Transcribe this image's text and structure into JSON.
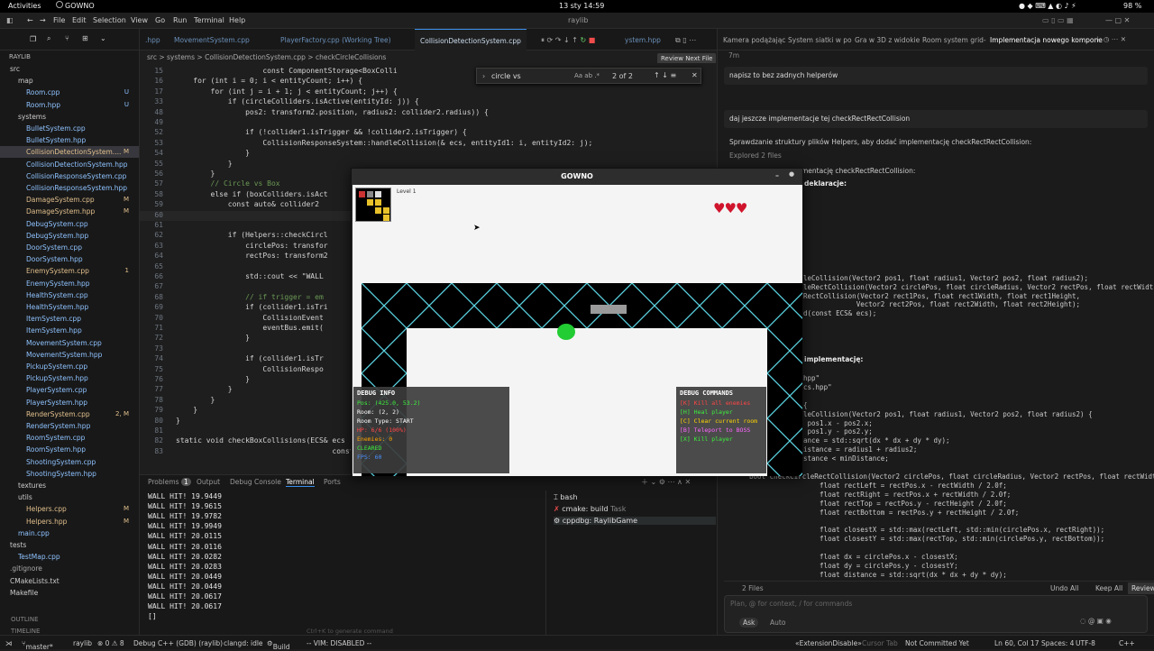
{
  "topbar": {
    "activities": "Activities",
    "app": "GOWNO",
    "clock": "13 sty  14:59",
    "battery": "98 %"
  },
  "menu": [
    "File",
    "Edit",
    "Selection",
    "View",
    "Go",
    "Run",
    "Terminal",
    "Help"
  ],
  "search_center": "raylib",
  "sidebar": {
    "project": "RAYLIB",
    "items": [
      {
        "t": "src",
        "d": 1,
        "c": "#ccc",
        "s": ""
      },
      {
        "t": "map",
        "d": 2,
        "c": "#ccc",
        "s": ""
      },
      {
        "t": "Room.cpp",
        "d": 3,
        "c": "#8fc3ff",
        "s": "U"
      },
      {
        "t": "Room.hpp",
        "d": 3,
        "c": "#8fc3ff",
        "s": "U"
      },
      {
        "t": "systems",
        "d": 2,
        "c": "#ccc",
        "s": ""
      },
      {
        "t": "BulletSystem.cpp",
        "d": 3,
        "c": "#8fc3ff",
        "s": ""
      },
      {
        "t": "BulletSystem.hpp",
        "d": 3,
        "c": "#8fc3ff",
        "s": ""
      },
      {
        "t": "CollisionDetectionSystem....",
        "d": 3,
        "c": "#e2c08d",
        "s": "M"
      },
      {
        "t": "CollisionDetectionSystem.hpp",
        "d": 3,
        "c": "#8fc3ff",
        "s": ""
      },
      {
        "t": "CollisionResponseSystem.cpp",
        "d": 3,
        "c": "#8fc3ff",
        "s": ""
      },
      {
        "t": "CollisionResponseSystem.hpp",
        "d": 3,
        "c": "#8fc3ff",
        "s": ""
      },
      {
        "t": "DamageSystem.cpp",
        "d": 3,
        "c": "#e2c08d",
        "s": "M"
      },
      {
        "t": "DamageSystem.hpp",
        "d": 3,
        "c": "#e2c08d",
        "s": "M"
      },
      {
        "t": "DebugSystem.cpp",
        "d": 3,
        "c": "#8fc3ff",
        "s": ""
      },
      {
        "t": "DebugSystem.hpp",
        "d": 3,
        "c": "#8fc3ff",
        "s": ""
      },
      {
        "t": "DoorSystem.cpp",
        "d": 3,
        "c": "#8fc3ff",
        "s": ""
      },
      {
        "t": "DoorSystem.hpp",
        "d": 3,
        "c": "#8fc3ff",
        "s": ""
      },
      {
        "t": "EnemySystem.cpp",
        "d": 3,
        "c": "#e2c08d",
        "s": "1"
      },
      {
        "t": "EnemySystem.hpp",
        "d": 3,
        "c": "#8fc3ff",
        "s": ""
      },
      {
        "t": "HealthSystem.cpp",
        "d": 3,
        "c": "#8fc3ff",
        "s": ""
      },
      {
        "t": "HealthSystem.hpp",
        "d": 3,
        "c": "#8fc3ff",
        "s": ""
      },
      {
        "t": "ItemSystem.cpp",
        "d": 3,
        "c": "#8fc3ff",
        "s": ""
      },
      {
        "t": "ItemSystem.hpp",
        "d": 3,
        "c": "#8fc3ff",
        "s": ""
      },
      {
        "t": "MovementSystem.cpp",
        "d": 3,
        "c": "#8fc3ff",
        "s": ""
      },
      {
        "t": "MovementSystem.hpp",
        "d": 3,
        "c": "#8fc3ff",
        "s": ""
      },
      {
        "t": "PickupSystem.cpp",
        "d": 3,
        "c": "#8fc3ff",
        "s": ""
      },
      {
        "t": "PickupSystem.hpp",
        "d": 3,
        "c": "#8fc3ff",
        "s": ""
      },
      {
        "t": "PlayerSystem.cpp",
        "d": 3,
        "c": "#8fc3ff",
        "s": ""
      },
      {
        "t": "PlayerSystem.hpp",
        "d": 3,
        "c": "#8fc3ff",
        "s": ""
      },
      {
        "t": "RenderSystem.cpp",
        "d": 3,
        "c": "#e2c08d",
        "s": "2, M"
      },
      {
        "t": "RenderSystem.hpp",
        "d": 3,
        "c": "#8fc3ff",
        "s": ""
      },
      {
        "t": "RoomSystem.cpp",
        "d": 3,
        "c": "#8fc3ff",
        "s": ""
      },
      {
        "t": "RoomSystem.hpp",
        "d": 3,
        "c": "#8fc3ff",
        "s": ""
      },
      {
        "t": "ShootingSystem.cpp",
        "d": 3,
        "c": "#8fc3ff",
        "s": ""
      },
      {
        "t": "ShootingSystem.hpp",
        "d": 3,
        "c": "#8fc3ff",
        "s": ""
      },
      {
        "t": "textures",
        "d": 2,
        "c": "#ccc",
        "s": ""
      },
      {
        "t": "utils",
        "d": 2,
        "c": "#ccc",
        "s": ""
      },
      {
        "t": "Helpers.cpp",
        "d": 3,
        "c": "#e2c08d",
        "s": "M"
      },
      {
        "t": "Helpers.hpp",
        "d": 3,
        "c": "#e2c08d",
        "s": "M"
      },
      {
        "t": "main.cpp",
        "d": 2,
        "c": "#8fc3ff",
        "s": ""
      },
      {
        "t": "tests",
        "d": 1,
        "c": "#ccc",
        "s": ""
      },
      {
        "t": "TestMap.cpp",
        "d": 2,
        "c": "#8fc3ff",
        "s": ""
      },
      {
        "t": ".gitignore",
        "d": 1,
        "c": "#aaa",
        "s": ""
      },
      {
        "t": "CMakeLists.txt",
        "d": 1,
        "c": "#ccc",
        "s": ""
      },
      {
        "t": "Makefile",
        "d": 1,
        "c": "#ccc",
        "s": ""
      }
    ],
    "outline": "OUTLINE",
    "timeline": "TIMELINE"
  },
  "editor_tabs": [
    ".hpp",
    "MovementSystem.cpp",
    "PlayerFactory.cpp (Working Tree)",
    "CollisionDetectionSystem.cpp",
    "ystem.hpp"
  ],
  "breadcrumbs": "src  >  systems  >  CollisionDetectionSystem.cpp  >  checkCircleCollisions",
  "review_next": "Review Next File",
  "find": {
    "query": "circle vs",
    "count": "2 of 2",
    "flags": "Aa  ab  .*"
  },
  "code": [
    {
      "n": "15",
      "t": "                    const ComponentStorage<BoxColli"
    },
    {
      "n": "16",
      "t": "    for (int i = 0; i < entityCount; i++) {"
    },
    {
      "n": "17",
      "t": "        for (int j = i + 1; j < entityCount; j++) {"
    },
    {
      "n": "33",
      "t": "            if (circleColliders.isActive(entityId: j)) {"
    },
    {
      "n": "48",
      "t": "                pos2: transform2.position, radius2: collider2.radius)) {"
    },
    {
      "n": "49",
      "t": ""
    },
    {
      "n": "52",
      "t": "                if (!collider1.isTrigger && !collider2.isTrigger) {"
    },
    {
      "n": "53",
      "t": "                    CollisionResponseSystem::handleCollision(& ecs, entityId1: i, entityId2: j);"
    },
    {
      "n": "54",
      "t": "                }"
    },
    {
      "n": "55",
      "t": "            }"
    },
    {
      "n": "56",
      "t": "        }"
    },
    {
      "n": "57",
      "t": "        // Circle vs Box"
    },
    {
      "n": "58",
      "t": "        else if (boxColliders.isAct"
    },
    {
      "n": "59",
      "t": "            const auto& collider2"
    },
    {
      "n": "60",
      "t": ""
    },
    {
      "n": "61",
      "t": ""
    },
    {
      "n": "62",
      "t": "            if (Helpers::checkCircl"
    },
    {
      "n": "63",
      "t": "                circlePos: transfor"
    },
    {
      "n": "64",
      "t": "                rectPos: transform2"
    },
    {
      "n": "65",
      "t": ""
    },
    {
      "n": "66",
      "t": "                std::cout << \"WALL"
    },
    {
      "n": "67",
      "t": ""
    },
    {
      "n": "68",
      "t": "                // if trigger = em"
    },
    {
      "n": "69",
      "t": "                if (collider1.isTri"
    },
    {
      "n": "70",
      "t": "                    CollisionEvent"
    },
    {
      "n": "71",
      "t": "                    eventBus.emit("
    },
    {
      "n": "72",
      "t": "                }"
    },
    {
      "n": "73",
      "t": ""
    },
    {
      "n": "74",
      "t": "                if (collider1.isTr"
    },
    {
      "n": "75",
      "t": "                    CollisionRespo"
    },
    {
      "n": "76",
      "t": "                }"
    },
    {
      "n": "77",
      "t": "            }"
    },
    {
      "n": "78",
      "t": "        }"
    },
    {
      "n": "79",
      "t": "    }"
    },
    {
      "n": "80",
      "t": "}"
    },
    {
      "n": "81",
      "t": ""
    },
    {
      "n": "82",
      "t": "static void checkBoxCollisions(ECS& ecs"
    },
    {
      "n": "83",
      "t": "                                    const st"
    }
  ],
  "panel_tabs": [
    "Problems",
    "Output",
    "Debug Console",
    "Terminal",
    "Ports"
  ],
  "problems_count": "1",
  "terminal_lines": [
    "WALL HIT! 19.9449",
    "WALL HIT! 19.9615",
    "WALL HIT! 19.9782",
    "WALL HIT! 19.9949",
    "WALL HIT! 20.0115",
    "WALL HIT! 20.0116",
    "WALL HIT! 20.0282",
    "WALL HIT! 20.0283",
    "WALL HIT! 20.0449",
    "WALL HIT! 20.0449",
    "WALL HIT! 20.0617",
    "WALL HIT! 20.0617",
    "[]"
  ],
  "terminals": [
    {
      "name": "bash"
    },
    {
      "name": "cmake: build",
      "extra": "Task"
    },
    {
      "name": "cppdbg: RaylibGame"
    }
  ],
  "ctrlk": "Ctrl+K to generate command",
  "game": {
    "title": "GOWNO",
    "level": "Level 1",
    "hearts": 3,
    "debug_info": {
      "title": "DEBUG INFO",
      "lines": [
        {
          "t": "Pos: (425.0, 53.2)",
          "c": "#3df03d"
        },
        {
          "t": "Room: (2, 2)",
          "c": "#fff"
        },
        {
          "t": "Room Type: START",
          "c": "#fff"
        },
        {
          "t": "HP: 6/6 (100%)",
          "c": "#ff4444"
        },
        {
          "t": "Enemies: 0",
          "c": "#ffa500"
        },
        {
          "t": "CLEARED",
          "c": "#3df03d"
        },
        {
          "t": "FPS: 60",
          "c": "#4a90ff"
        }
      ]
    },
    "debug_cmds": {
      "title": "DEBUG COMMANDS",
      "lines": [
        {
          "t": "[K] Kill all enemies",
          "c": "#ff4444"
        },
        {
          "t": "[H] Heal player",
          "c": "#3df03d"
        },
        {
          "t": "[C] Clear current room",
          "c": "#ffd700"
        },
        {
          "t": "[B] Teleport to BOSS",
          "c": "#ff66ff"
        },
        {
          "t": "[X] Kill player",
          "c": "#3df03d"
        }
      ]
    }
  },
  "chat_tabs": [
    "Kamera podążając",
    "System siatki w po",
    "Gra w 3D z widokie",
    "Room system grid-",
    "Implementacja nowego kompone"
  ],
  "chat": {
    "time": "7m",
    "user1": "napisz to bez zadnych helperów",
    "user2": "daj jeszcze implementacje tej checkRectRectCollision",
    "assistant": "Sprawdzanie struktury plików Helpers, aby dodać implementację checkRectRectCollision:",
    "explored": "Explored 2 files",
    "impl_head": "mentację checkRectRectCollision:",
    "decl_head": "deklaracje:",
    "impl2_head": "implementację:",
    "decl_code": [
      "leCollision(Vector2 pos1, float radius1, Vector2 pos2, float radius2);",
      "leRectCollision(Vector2 circlePos, float circleRadius, Vector2 rectPos, float rectWidt",
      "RectCollision(Vector2 rect1Pos, float rect1Width, float rect1Height,",
      "             Vector2 rect2Pos, float rect2Width, float rect2Height);",
      "d(const ECS& ecs);"
    ],
    "impl_code": [
      "hpp\"",
      "cs.hpp\"",
      "",
      "{",
      "leCollision(Vector2 pos1, float radius1, Vector2 pos2, float radius2) {",
      " pos1.x - pos2.x;",
      " pos1.y - pos2.y;",
      "ance = std::sqrt(dx * dx + dy * dy);",
      "istance = radius1 + radius2;",
      "stance < minDistance;",
      "",
      "bool checkCircleRectCollision(Vector2 circlePos, float circleRadius, Vector2 rectPos, float rectWidt",
      "    float rectLeft = rectPos.x - rectWidth / 2.0f;",
      "    float rectRight = rectPos.x + rectWidth / 2.0f;",
      "    float rectTop = rectPos.y - rectHeight / 2.0f;",
      "    float rectBottom = rectPos.y + rectHeight / 2.0f;",
      "",
      "    float closestX = std::max(rectLeft, std::min(circlePos.x, rectRight));",
      "    float closestY = std::max(rectTop, std::min(circlePos.y, rectBottom));",
      "",
      "    float dx = circlePos.x - closestX;",
      "    float dy = circlePos.y - closestY;",
      "    float distance = std::sqrt(dx * dx + dy * dy);"
    ],
    "files": "2 Files",
    "undo": "Undo All",
    "keep": "Keep All",
    "review": "Review",
    "placeholder": "Plan, @ for context, / for commands",
    "mode": "Ask",
    "model": "Auto"
  },
  "status": {
    "branch": "master*",
    "repo": "raylib",
    "errors": "⊗ 0 ⚠ 8",
    "debug": "Debug C++ (GDB) (raylib)",
    "clangd": "clangd: idle",
    "build": "Build",
    "vim": "-- VIM: DISABLED --",
    "ext": "«ExtensionDisable»",
    "cursor_tab": "Cursor Tab",
    "commit": "Not Committed Yet",
    "pos": "Ln 60, Col 17",
    "spaces": "Spaces: 4",
    "enc": "UTF-8",
    "lang": "C++"
  }
}
